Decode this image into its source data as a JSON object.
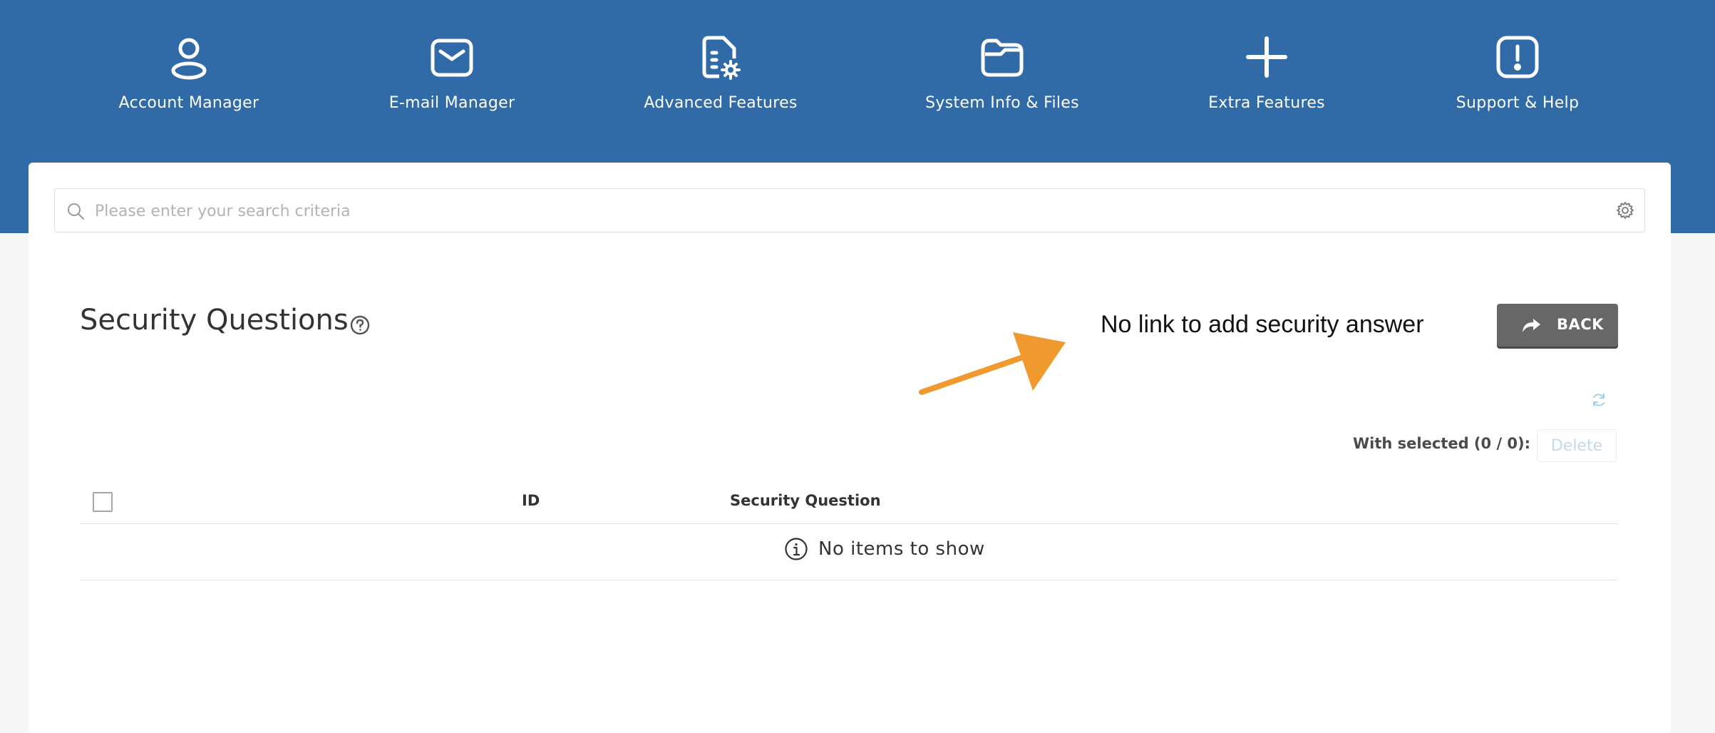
{
  "nav": {
    "items": [
      {
        "label": "Account Manager",
        "icon": "user-icon"
      },
      {
        "label": "E-mail Manager",
        "icon": "mail-icon"
      },
      {
        "label": "Advanced Features",
        "icon": "file-gear-icon"
      },
      {
        "label": "System Info & Files",
        "icon": "folder-icon"
      },
      {
        "label": "Extra Features",
        "icon": "plus-icon"
      },
      {
        "label": "Support & Help",
        "icon": "alert-square-icon"
      }
    ]
  },
  "search": {
    "placeholder": "Please enter your search criteria",
    "value": ""
  },
  "page": {
    "title": "Security Questions"
  },
  "annotation": {
    "text": "No link to add security answer",
    "color": "#f0992f"
  },
  "toolbar": {
    "back_label": "BACK",
    "with_selected_label": "With selected (0 / 0):",
    "delete_label": "Delete"
  },
  "table": {
    "columns": [
      "ID",
      "Security Question"
    ],
    "empty_message": "No items to show",
    "rows": []
  },
  "colors": {
    "header_bg": "#316ba7",
    "back_button": "#676767",
    "page_bg": "#f6f6f6"
  }
}
